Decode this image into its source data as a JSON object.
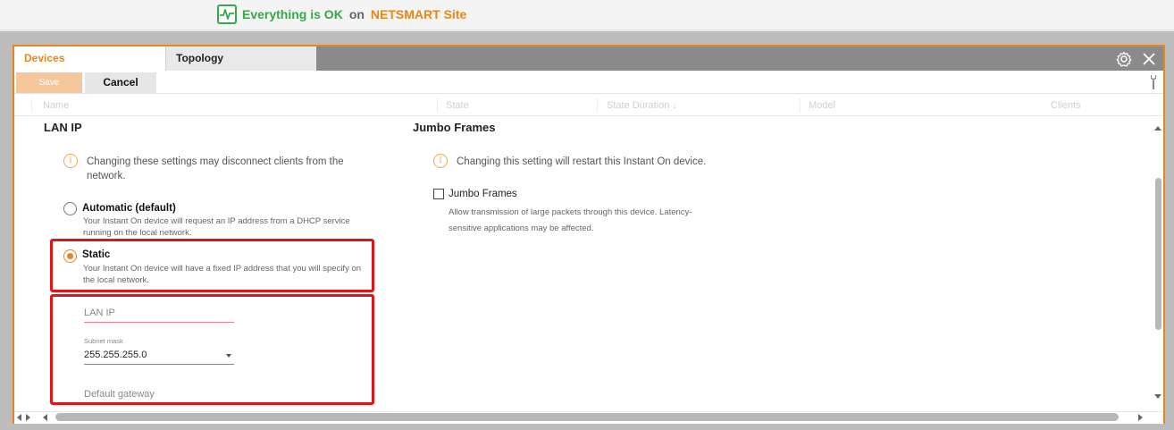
{
  "status": {
    "message": "Everything is OK",
    "connector": "on",
    "site": "NETSMART Site",
    "icon": "pulse-monitor-icon"
  },
  "tabs": [
    {
      "label": "Devices",
      "active": true
    },
    {
      "label": "Topology",
      "active": false
    }
  ],
  "toolbar": {
    "save_label": "Save",
    "cancel_label": "Cancel"
  },
  "columns": [
    "Name",
    "State",
    "State Duration ↓",
    "Model",
    "Clients"
  ],
  "lan_ip": {
    "title": "LAN IP",
    "warning": "Changing these settings may disconnect clients from the network.",
    "options": [
      {
        "label": "Automatic (default)",
        "description": "Your Instant On device will request an IP address from a DHCP service running on the local network.",
        "selected": false
      },
      {
        "label": "Static",
        "description": "Your Instant On device will have a fixed IP address that you will specify on the local network.",
        "selected": true
      }
    ],
    "fields": {
      "lan_ip_placeholder": "LAN IP",
      "subnet_label": "Subnet mask",
      "subnet_value": "255.255.255.0",
      "gateway_placeholder": "Default gateway"
    }
  },
  "jumbo": {
    "title": "Jumbo Frames",
    "warning": "Changing this setting will restart this Instant On device.",
    "checkbox_label": "Jumbo Frames",
    "checked": false,
    "description_line1": "Allow transmission of large packets through this device. Latency-",
    "description_line2": "sensitive applications may be affected."
  },
  "colors": {
    "accent": "#e8861a",
    "ok": "#3aa64a",
    "highlight": "#e01515"
  }
}
